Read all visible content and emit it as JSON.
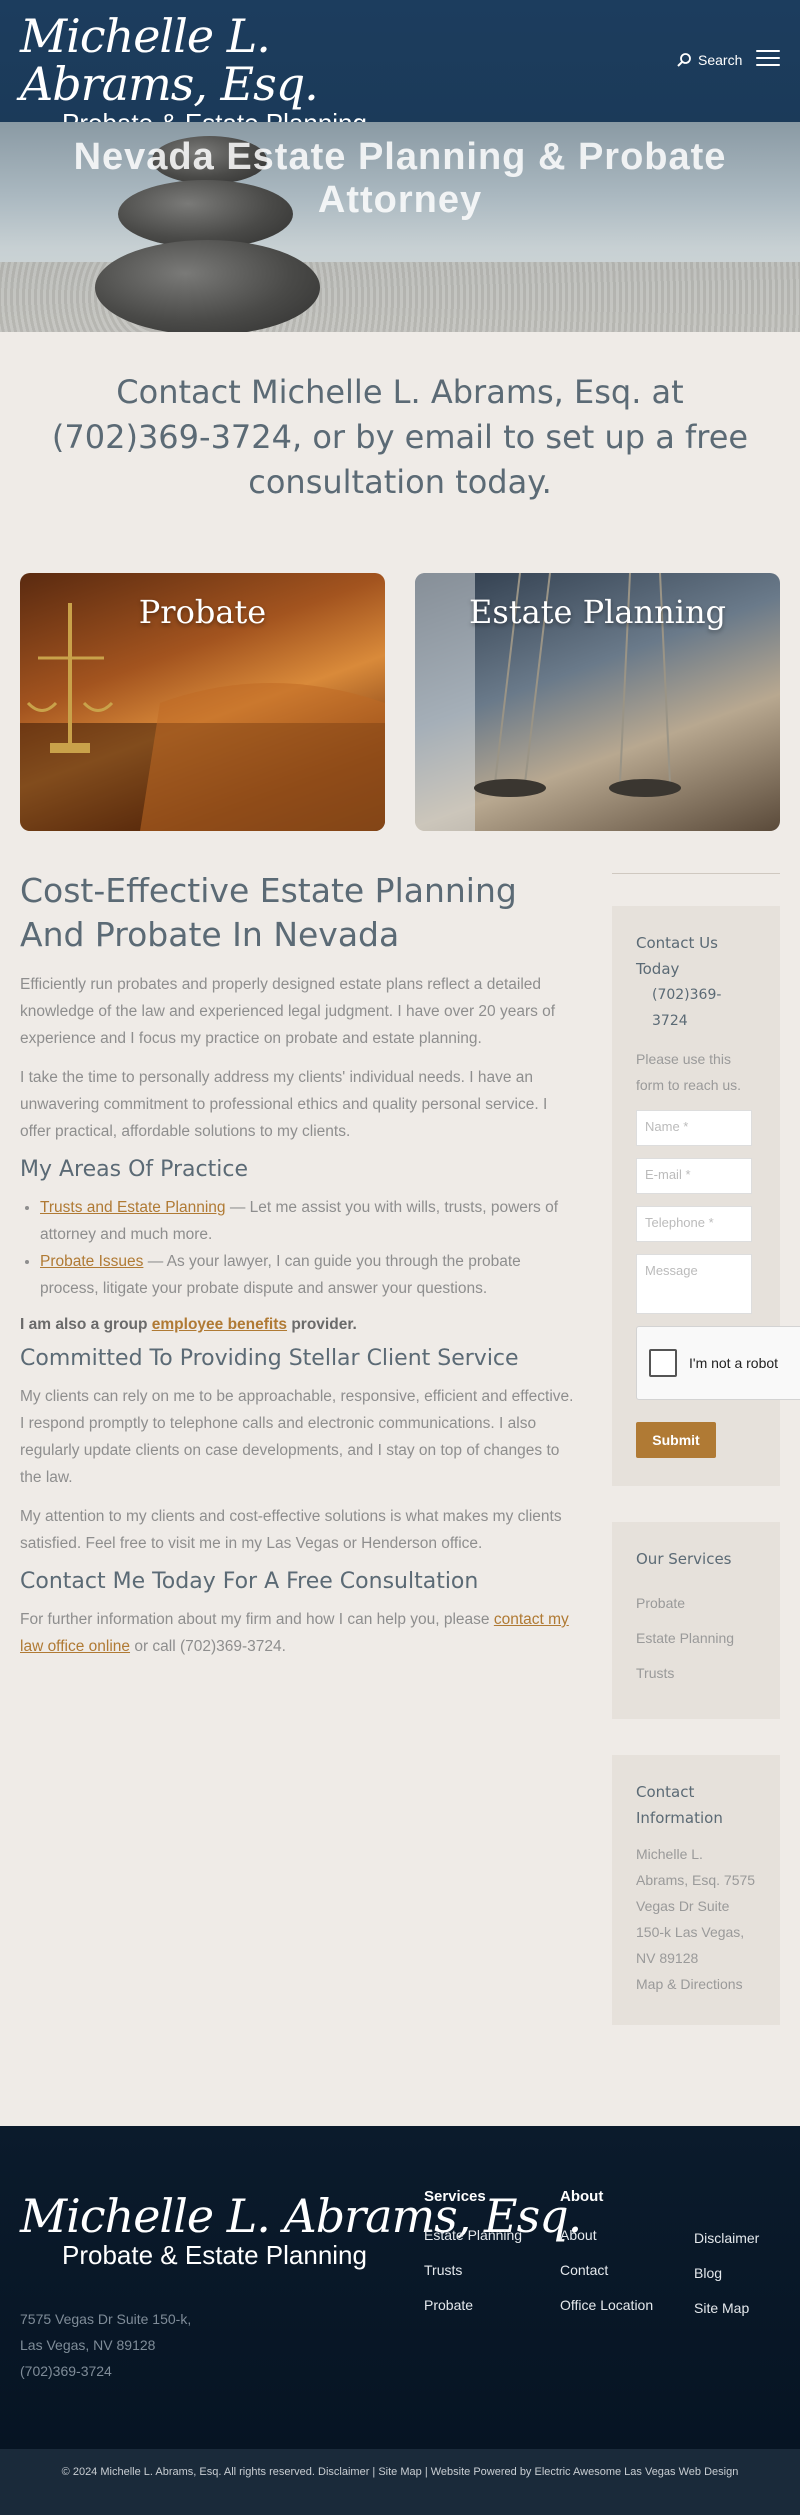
{
  "header": {
    "logo_script": "Michelle L. Abrams, Esq.",
    "logo_sub": "Probate & Estate Planning",
    "search_label": "Search"
  },
  "hero": {
    "title": "Nevada Estate Planning & Probate Attorney"
  },
  "banner": {
    "text": "Contact Michelle L. Abrams, Esq. at (702)369-3724, or by email to set up a free consultation today."
  },
  "cards": [
    {
      "label": "Probate"
    },
    {
      "label": "Estate Planning"
    }
  ],
  "main": {
    "title": "Cost-Effective Estate Planning And Probate In Nevada",
    "p1": "Efficiently run probates and properly designed estate plans reflect a detailed knowledge of the law and experienced legal judgment. I have over 20 years of experience and I focus my practice on probate and estate planning.",
    "p2": "I take the time to personally address my clients' individual needs. I have an unwavering commitment to professional ethics and quality personal service. I offer practical, affordable solutions to my clients.",
    "areas_heading": "My Areas Of Practice",
    "areas": [
      {
        "link": "Trusts and Estate Planning",
        "text": " — Let me assist you with wills, trusts, powers of attorney and much more."
      },
      {
        "link": "Probate Issues",
        "text": " — As your lawyer, I can guide you through the probate process, litigate your probate dispute and answer your questions."
      }
    ],
    "group_pre": "I am also a group ",
    "group_link": "employee benefits",
    "group_post": " provider.",
    "committed_heading": "Committed To Providing Stellar Client Service",
    "p3": "My clients can rely on me to be approachable, responsive, efficient and effective. I respond promptly to telephone calls and electronic communications. I also regularly update clients on case developments, and I stay on top of changes to the law.",
    "p4": "My attention to my clients and cost-effective solutions is what makes my clients satisfied. Feel free to visit me in my Las Vegas or Henderson office.",
    "contact_heading": "Contact Me Today For A Free Consultation",
    "p5_pre": "For further information about my firm and how I can help you, please ",
    "p5_link": "contact my law office online",
    "p5_post": " or call (702)369-3724."
  },
  "sidebar": {
    "contact_title": "Contact Us Today",
    "contact_phone": "(702)369-3724",
    "contact_note": "Please use this form to reach us.",
    "name_placeholder": "Name *",
    "email_placeholder": "E-mail *",
    "phone_placeholder": "Telephone *",
    "message_placeholder": "Message",
    "captcha_label": "I'm not a robot",
    "submit_label": "Submit",
    "services_title": "Our Services",
    "services": [
      "Probate",
      "Estate Planning",
      "Trusts"
    ],
    "info_title": "Contact Information",
    "info_address": "Michelle L. Abrams, Esq. 7575 Vegas Dr Suite 150-k Las Vegas, NV 89128",
    "info_link": "Map & Directions"
  },
  "footer": {
    "address_line1": "7575 Vegas Dr Suite 150-k,",
    "address_line2": "Las Vegas, NV 89128",
    "phone": "(702)369-3724",
    "services_heading": "Services",
    "services": [
      "Estate Planning",
      "Trusts",
      "Probate"
    ],
    "about_heading": "About",
    "about": [
      "About",
      "Contact",
      "Office Location"
    ],
    "misc": [
      "Disclaimer",
      "Blog",
      "Site Map"
    ],
    "copyright": "© 2024 Michelle L. Abrams, Esq. All rights reserved.",
    "disclaimer": "Disclaimer",
    "sitemap": "Site Map",
    "powered_pre": "Website Powered by Electric Awesome",
    "powered_link": "Las Vegas Web Design"
  },
  "colors": {
    "header_bg": "#1c3d5e",
    "page_bg": "#efebe7",
    "accent": "#b07a34",
    "footer_bg": "#0b1b2c",
    "heading": "#5b6a75"
  }
}
